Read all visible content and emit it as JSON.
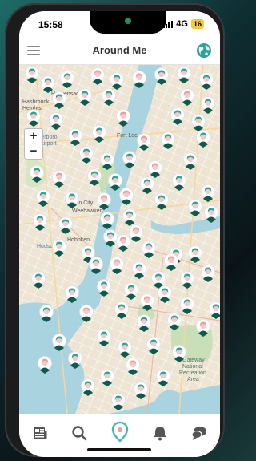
{
  "status": {
    "time": "15:58",
    "network": "4G",
    "battery": "16"
  },
  "header": {
    "title": "Around Me"
  },
  "map": {
    "zoom_in": "+",
    "zoom_out": "−",
    "labels": [
      {
        "text": "Hackensack"
      },
      {
        "text": "Hasbrouck"
      },
      {
        "text": "Heights"
      },
      {
        "text": "Teterboro"
      },
      {
        "text": "Airport"
      },
      {
        "text": "Fort Lee"
      },
      {
        "text": "Union City"
      },
      {
        "text": "Weehawken"
      },
      {
        "text": "Hoboken"
      },
      {
        "text": "Hudson"
      },
      {
        "text": "Gateway"
      },
      {
        "text": "National"
      },
      {
        "text": "Recreation"
      },
      {
        "text": "Area"
      }
    ]
  },
  "tabs": [
    {
      "name": "news",
      "icon": "newspaper-icon"
    },
    {
      "name": "search",
      "icon": "search-icon"
    },
    {
      "name": "around-me",
      "icon": "location-pin-icon"
    },
    {
      "name": "notifications",
      "icon": "bell-icon"
    },
    {
      "name": "chat",
      "icon": "chat-icon"
    }
  ],
  "colors": {
    "accent": "#49b7b2",
    "water": "#a9d3df",
    "park": "#c9dfb8",
    "header_bg": "#ffffff",
    "pin_head": "#f4c9c9",
    "pin_hair_teal": "#2fa39a",
    "pin_hair_pink": "#e8a1a1",
    "pin_body": "#0f5a4f"
  }
}
